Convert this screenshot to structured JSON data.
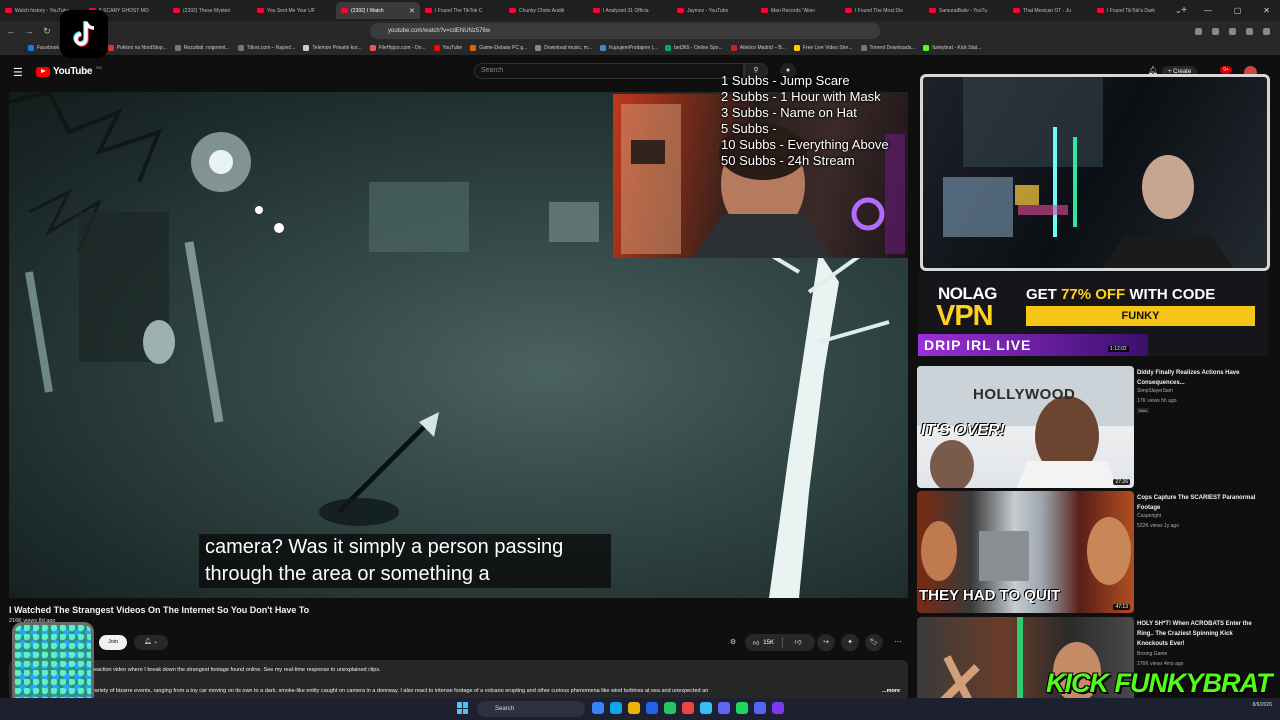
{
  "browser": {
    "tabs": [
      {
        "title": "Watch history - YouTube",
        "active": false
      },
      {
        "title": "5 SCARY GHOST MO",
        "active": false
      },
      {
        "title": "(2392) These Mysteri",
        "active": false
      },
      {
        "title": "You Sent Me Your UF",
        "active": false
      },
      {
        "title": "(2392) I Watch",
        "active": true
      },
      {
        "title": "I Found The TikTok C",
        "active": false
      },
      {
        "title": "Chunky Choto Auditi",
        "active": false
      },
      {
        "title": "I Analyzed 31 Officia",
        "active": false
      },
      {
        "title": "Jaymez - YouTube",
        "active": false
      },
      {
        "title": "Man Records \"Alien",
        "active": false
      },
      {
        "title": "I Found The Most Dis",
        "active": false
      },
      {
        "title": "SamuraiBaitv - YouTu",
        "active": false
      },
      {
        "title": "That Mexican OT - Ju",
        "active": false
      },
      {
        "title": "I Found TikTok's Dark",
        "active": false
      }
    ],
    "url": "youtube.com/watch?v=cdENUNz576w",
    "bookmarks": [
      "Facebook",
      "prepoznavanje",
      "Pokloni na NordStop...",
      "Rezultati: nogomet...",
      "Titlovi.com – Najveć...",
      "Telemon Privatni kor...",
      "FileHippo.com - Do...",
      "YouTube",
      "Game-Debate PC g...",
      "Download music, m...",
      "KupujemProdajem |...",
      "bet365 - Online Spo...",
      "Atletico Madrid – B...",
      "Free Live Video Stre...",
      "Torrent Downloads...",
      "funkybrat - Kick Stat..."
    ]
  },
  "youtube": {
    "logo_text": "YouTube",
    "country_code": "RS",
    "search_placeholder": "Search",
    "create_label": "+ Create",
    "notifications_count": "9+"
  },
  "video": {
    "caption_lines": [
      "camera? Was it simply a person passing",
      "through the area or something a"
    ],
    "title": "I Watched The Strangest Videos On The Internet So You Don't Have To",
    "views": "216K views  8d ago",
    "join_label": "Join",
    "like_count": "15K",
    "description_1": "reaction video where I break down the strangest footage found online. See my real-time response to unexplained clips.",
    "description_2": "variety of bizarre events, ranging from a toy car moving on its own to a dark, smoke-like entity caught on camera in a doorway. I also react to intense footage of a volcano erupting and other curious phenomena like wind turbines at sea and unexpected an",
    "more_label": "...more"
  },
  "overlay": {
    "sub_goals": [
      "1 Subbs - Jump Scare",
      "2 Subbs - 1 Hour with Mask",
      "3 Subbs - Name on Hat",
      "5 Subbs -",
      "10 Subbs - Everything Above",
      "50 Subbs - 24h Stream"
    ],
    "kick_logo": "KICK FUNKYBRAT"
  },
  "vpn_ad": {
    "logo_top": "NOLAG",
    "logo_bottom": "VPN",
    "offer_prefix": "GET ",
    "offer_pct": "77% OFF",
    "offer_suffix": " WITH CODE",
    "code": "FUNKY",
    "strip_text": "DRIP IRL LIVE",
    "duration": "1:12:02"
  },
  "recommendations": [
    {
      "title": "Diddy Finally Realizes Actions Have Consequences...",
      "channel": "SimpSlayerSam",
      "meta": "17K views  5h ago",
      "badge": "New",
      "duration": "27:26",
      "thumb_text_1": "HOLLYWOOD",
      "thumb_text_2": "IT'S OVER!"
    },
    {
      "title": "Cops Capture The SCARIEST Paranormal Footage",
      "channel": "Casperight",
      "meta": "522K views  1y ago",
      "duration": "47:13",
      "thumb_text_1": "THEY HAD TO QUIT"
    },
    {
      "title": "HOLY SH*T! When ACROBATS Enter the Ring.. The Craziest Spinning Kick Knockouts Ever!",
      "channel": "Boxing Game",
      "meta": "276K views  4mo ago"
    }
  ],
  "taskbar": {
    "search_label": "Search",
    "time": "8/6/2026"
  },
  "colors": {
    "youtube_red": "#ff0000",
    "kick_green": "#53fc18",
    "vpn_yellow": "#f5c518",
    "page_bg": "#0f0f0f"
  }
}
